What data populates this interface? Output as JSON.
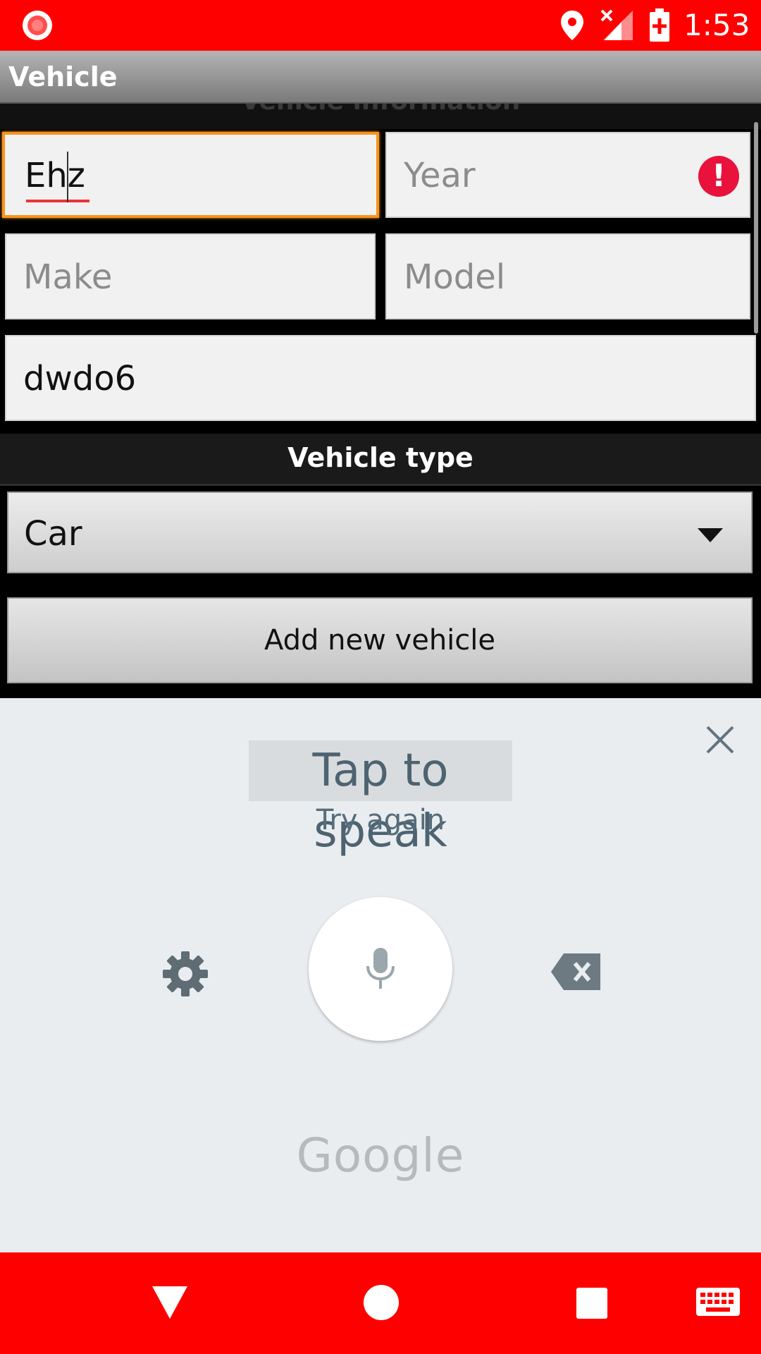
{
  "status_bar": {
    "time": "1:53",
    "icons": [
      "screen-record-icon",
      "location-icon",
      "no-signal-icon",
      "battery-charging-icon"
    ]
  },
  "action_bar": {
    "title": "Vehicle"
  },
  "form": {
    "section_header": "Vehicle information",
    "name_value": "Ehz",
    "year_placeholder": "Year",
    "make_placeholder": "Make",
    "model_placeholder": "Model",
    "plate_value": "dwdo6",
    "vehicle_type_label": "Vehicle type",
    "vehicle_type_selected": "Car",
    "add_button_label": "Add new vehicle"
  },
  "voice_input": {
    "prompt": "Tap to speak",
    "status": "Try again",
    "brand": "Google"
  },
  "colors": {
    "status_bar": "#ff0000",
    "focus_border": "#f7941d",
    "error": "#e8123d",
    "voice_panel_bg": "#e9edf0"
  }
}
